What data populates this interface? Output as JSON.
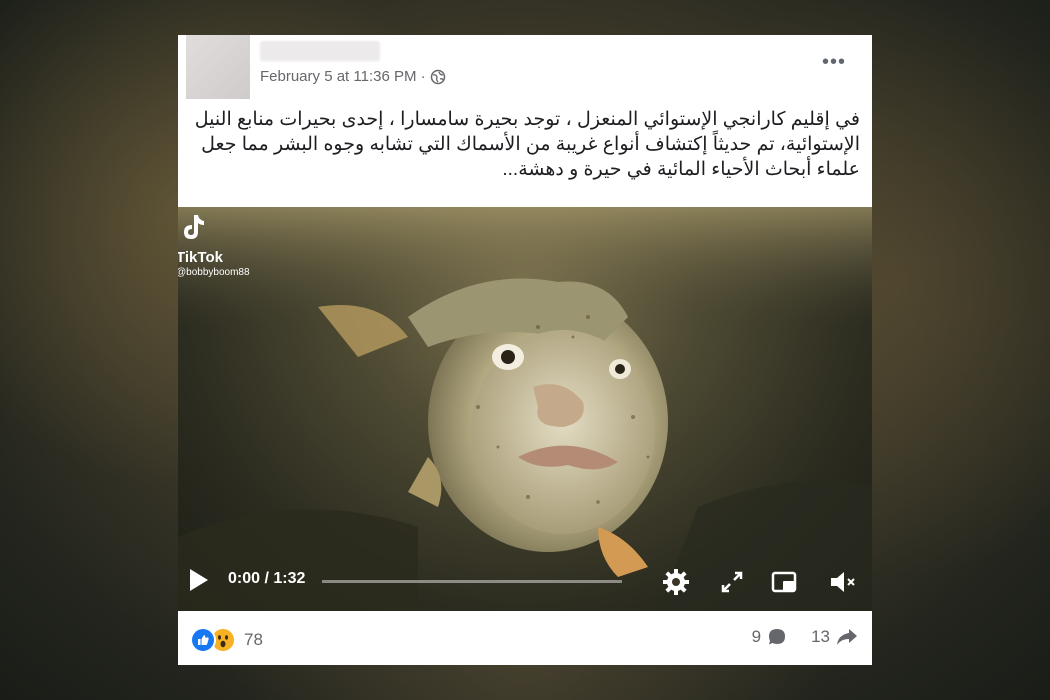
{
  "post": {
    "timestamp": "February 5 at 11:36 PM ·",
    "more_icon": "more-dots-icon",
    "privacy_icon": "globe-icon",
    "text": "في إقليم كارانجي الإستوائي المنعزل ، توجد بحيرة سامسارا ، إحدى بحيرات منابع النيل الإستوائية، تم حديثاً إكتشاف أنواع غريبة من الأسماك التي تشابه وجوه البشر مما جعل علماء أبحاث الأحياء المائية في حيرة و دهشة..."
  },
  "video": {
    "watermark_brand": "TikTok",
    "watermark_handle": "@bobbyboom88",
    "time": "0:00 / 1:32",
    "progress": 0.0
  },
  "footer": {
    "reaction_count": "78",
    "comment_count": "9",
    "share_count": "13"
  },
  "colors": {
    "like_blue": "#1877f2",
    "wow_yellow": "#f7b125",
    "meta_gray": "#65676b"
  }
}
